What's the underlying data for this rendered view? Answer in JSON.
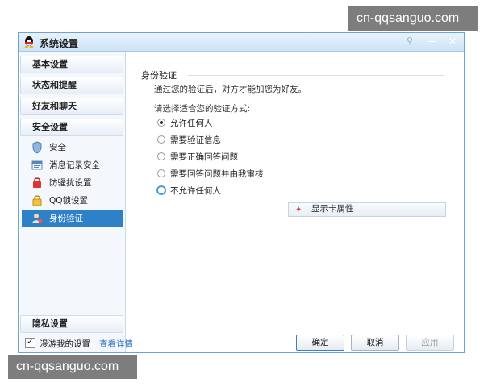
{
  "watermark": {
    "text": "cn-qqsanguo.com"
  },
  "window": {
    "title": "系统设置"
  },
  "sidebar": {
    "sections": [
      {
        "label": "基本设置"
      },
      {
        "label": "状态和提醒"
      },
      {
        "label": "好友和聊天"
      },
      {
        "label": "安全设置"
      }
    ],
    "items": [
      {
        "label": "安全",
        "icon": "shield-icon"
      },
      {
        "label": "消息记录安全",
        "icon": "message-history-icon"
      },
      {
        "label": "防骚扰设置",
        "icon": "anti-harass-icon"
      },
      {
        "label": "QQ锁设置",
        "icon": "lock-icon"
      },
      {
        "label": "身份验证",
        "icon": "identity-icon",
        "active": true
      }
    ],
    "privacy": {
      "label": "隐私设置"
    }
  },
  "content": {
    "group_title": "身份验证",
    "description": "通过您的验证后，对方才能加您为好友。",
    "prompt": "请选择适合您的验证方式:",
    "options": [
      {
        "label": "允许任何人",
        "checked": true
      },
      {
        "label": "需要验证信息",
        "checked": false
      },
      {
        "label": "需要正确回答问题",
        "checked": false
      },
      {
        "label": "需要回答问题并由我审核",
        "checked": false
      },
      {
        "label": "不允许任何人",
        "checked": false
      }
    ],
    "card_button": {
      "label": "显示卡属性"
    }
  },
  "footer": {
    "roam_label": "漫游我的设置",
    "detail_link": "查看详情",
    "ok": "确定",
    "cancel": "取消",
    "apply": "应用"
  },
  "colors": {
    "accent": "#2e80c9",
    "title_bg": "#cde3f6",
    "link": "#2a6fc0"
  }
}
